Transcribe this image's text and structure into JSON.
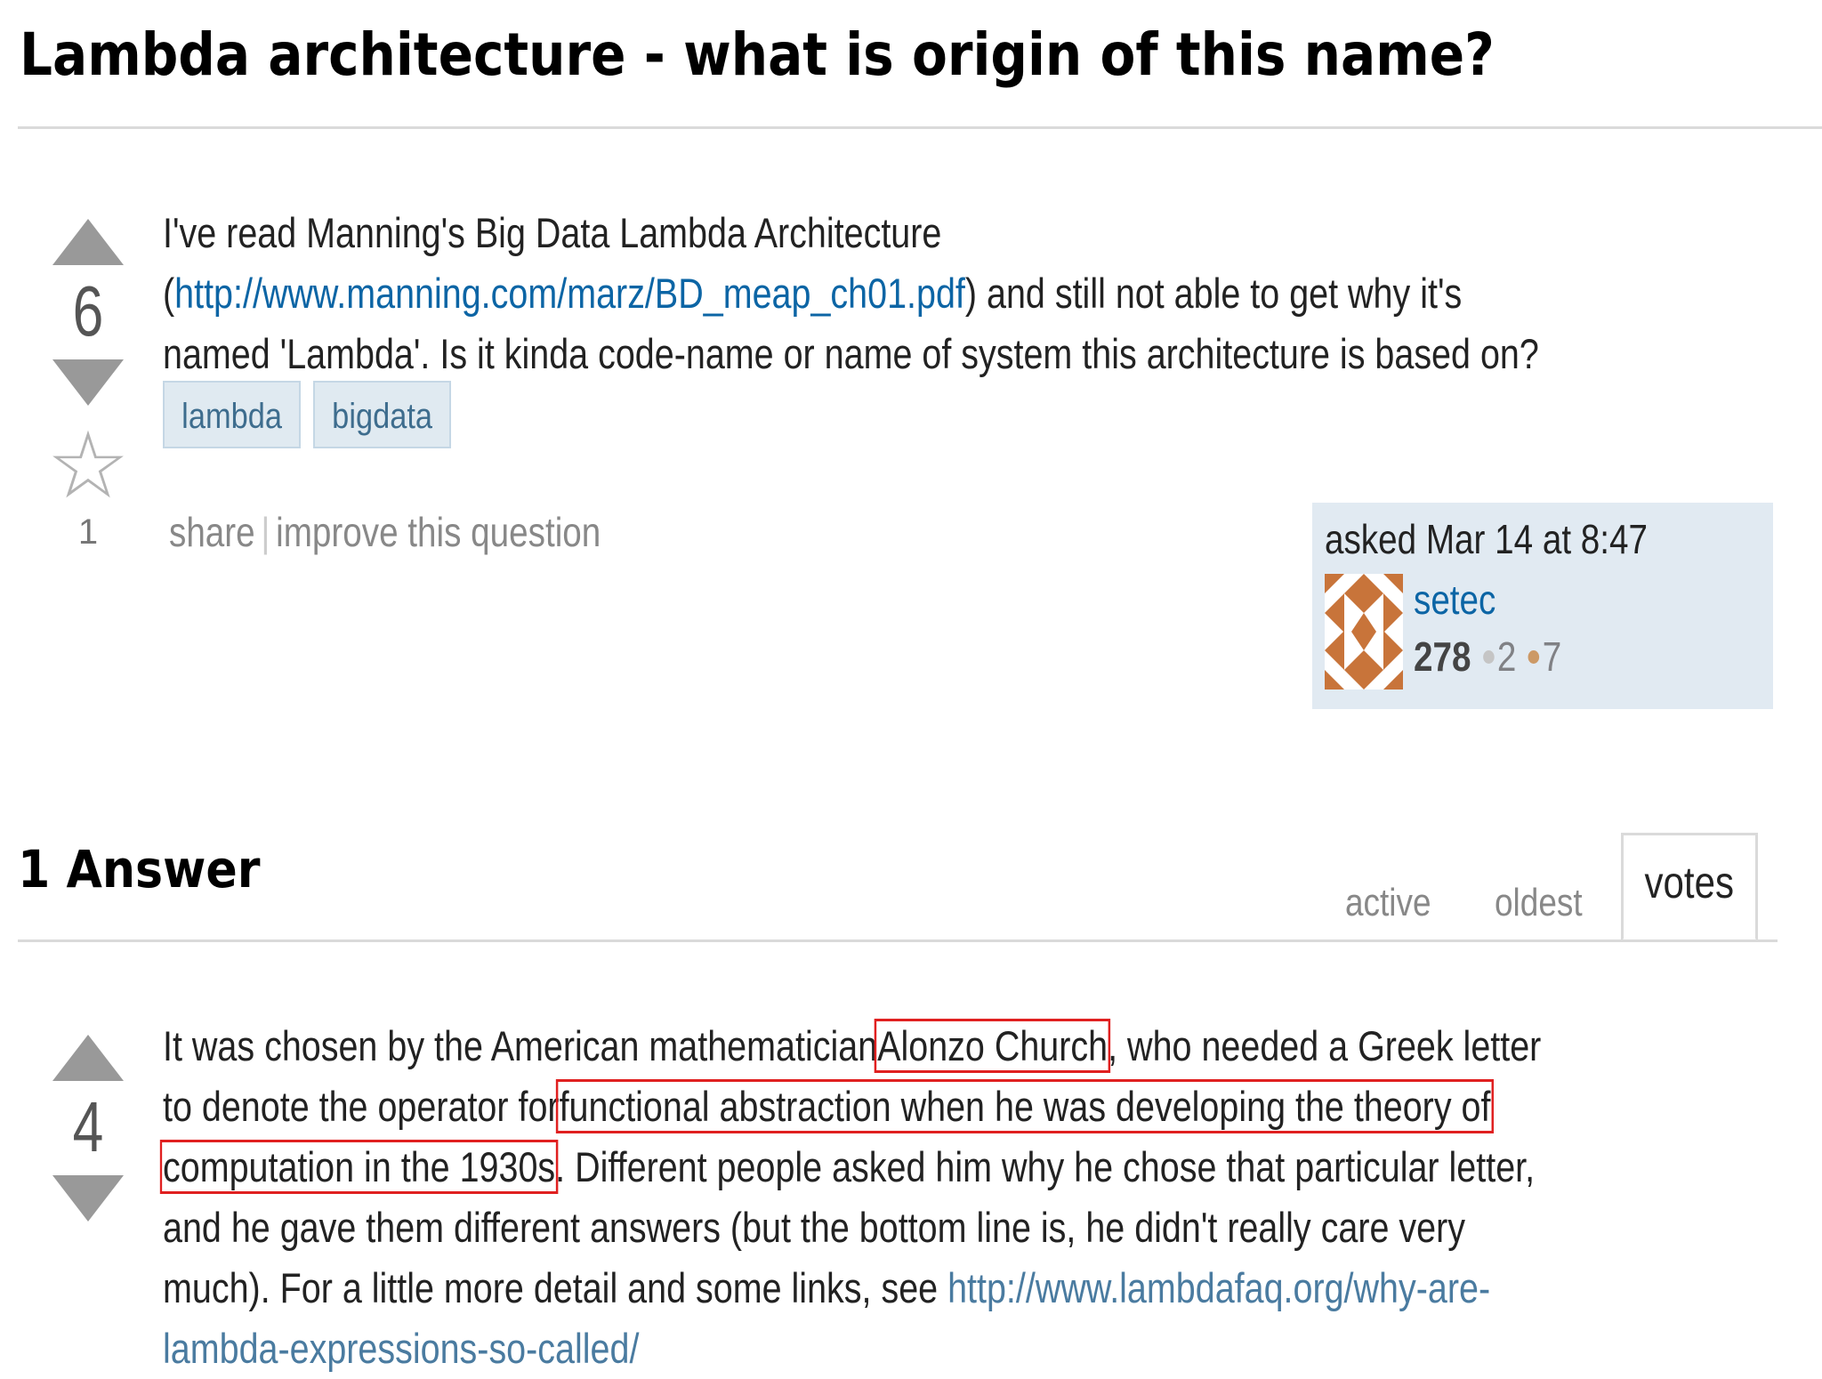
{
  "question": {
    "title": "Lambda architecture - what is origin of this name?",
    "vote_count": "6",
    "favorite_count": "1",
    "body_before_link": "I've read Manning's Big Data Lambda Architecture (",
    "link_text": "http://www.manning.com/marz/BD_meap_ch01.pdf",
    "body_after_link": ") and still not able to get why it's named 'Lambda'. Is it kinda code-name or name of system this architecture is based on?",
    "tags": [
      "lambda",
      "bigdata"
    ],
    "menu": {
      "share": "share",
      "separator": "|",
      "improve": "improve this question"
    },
    "owner": {
      "asked": "asked Mar 14 at 8:47",
      "name": "setec",
      "reputation": "278",
      "silver_badges": "2",
      "bronze_badges": "7"
    }
  },
  "answers_section": {
    "header": "1 Answer",
    "tabs": {
      "active": "active",
      "oldest": "oldest",
      "votes": "votes"
    },
    "selected_tab": "votes"
  },
  "answer": {
    "vote_count": "4",
    "text_1": "It was chosen by the American mathematician",
    "highlight_1": "Alonzo Church",
    "text_2": ", who needed a Greek letter to denote the operator for",
    "highlight_2": "functional abstraction when he was developing the theory of computation in the 1930s",
    "text_3": ". Different people asked him why he chose that particular letter, and he gave them different answers (but the bottom line is, he didn't really care very much). For a little more detail and some links, see ",
    "link_text": "http://www.lambdafaq.org/why-are-lambda-expressions-so-called/"
  },
  "colors": {
    "link": "#0c65a5",
    "tag_bg": "#e0eaf1",
    "owner_card_bg": "#e1eaf2",
    "vote_arrow": "#999999",
    "highlight_box": "#e02020",
    "bronze_badge": "#cc9966",
    "silver_badge": "#c5c5c5"
  },
  "icons": {
    "upvote": "upvote-arrow-icon",
    "downvote": "downvote-arrow-icon",
    "favorite": "star-icon",
    "avatar": "identicon-avatar"
  }
}
